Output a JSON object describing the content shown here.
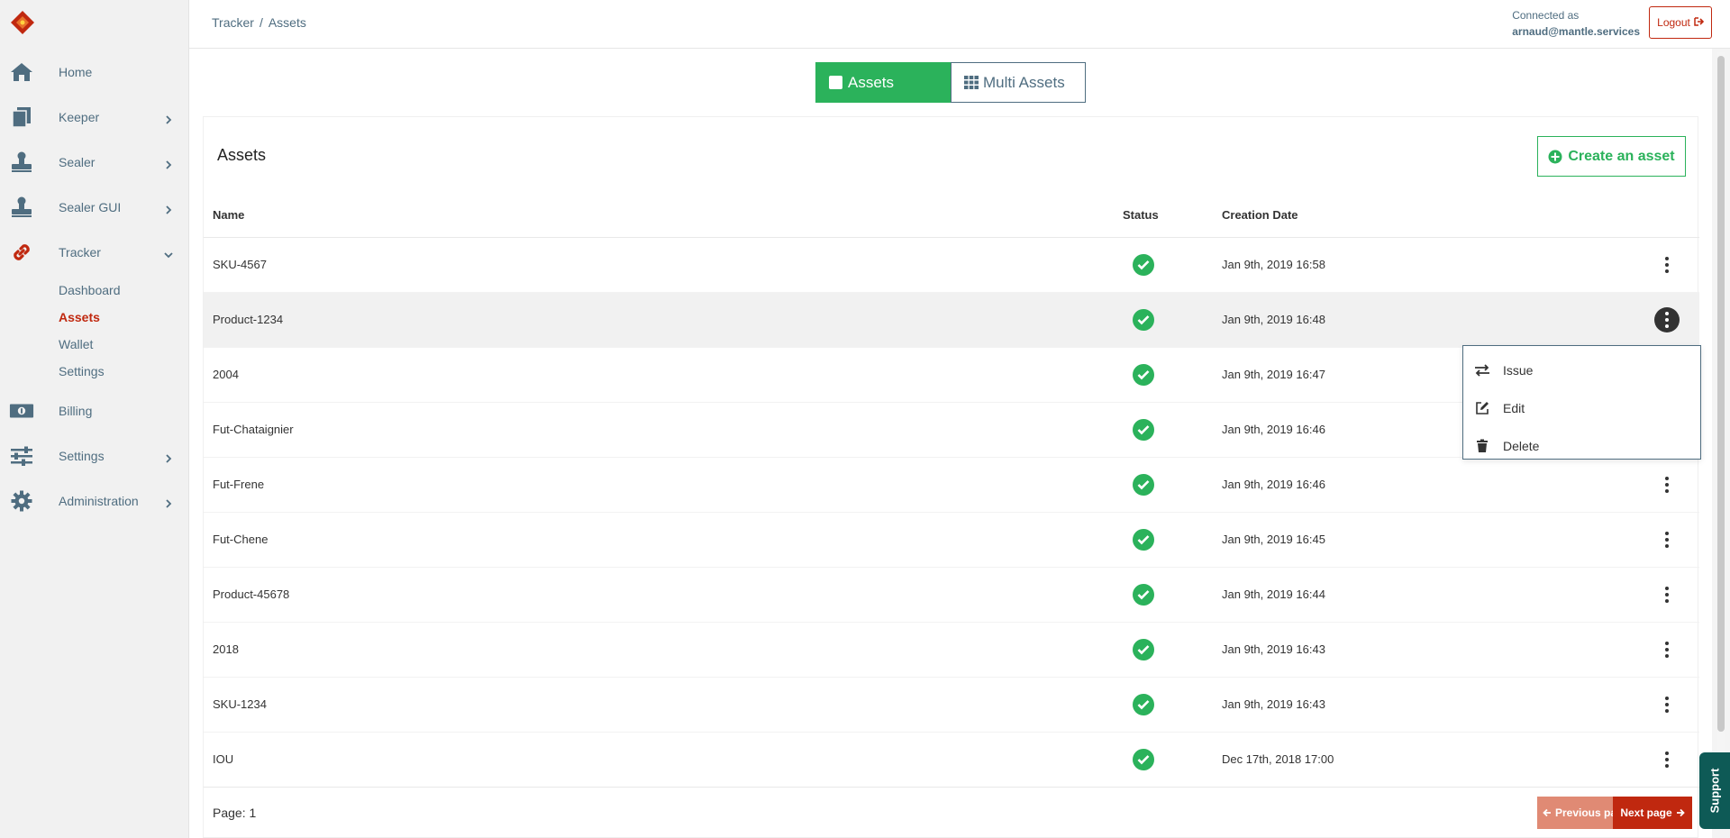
{
  "sidebar": {
    "items": [
      {
        "label": "Home",
        "icon": "home-icon"
      },
      {
        "label": "Keeper",
        "icon": "documents-icon"
      },
      {
        "label": "Sealer",
        "icon": "stamp-icon"
      },
      {
        "label": "Sealer GUI",
        "icon": "stamp-icon"
      },
      {
        "label": "Tracker",
        "icon": "link-icon"
      },
      {
        "label": "Billing",
        "icon": "money-icon"
      },
      {
        "label": "Settings",
        "icon": "sliders-icon"
      },
      {
        "label": "Administration",
        "icon": "gear-icon"
      }
    ],
    "tracker_sub": [
      "Dashboard",
      "Assets",
      "Wallet",
      "Settings"
    ]
  },
  "header": {
    "breadcrumb": [
      "Tracker",
      "Assets"
    ],
    "connected_label": "Connected as",
    "user": "arnaud@mantle.services",
    "logout_label": "Logout"
  },
  "toggle": {
    "assets_label": "Assets",
    "multi_label": "Multi Assets"
  },
  "panel": {
    "title": "Assets",
    "create_label": "Create an asset"
  },
  "table": {
    "headers": [
      "Name",
      "Status",
      "Creation Date"
    ],
    "rows": [
      {
        "name": "SKU-4567",
        "date": "Jan 9th, 2019 16:58"
      },
      {
        "name": "Product-1234",
        "date": "Jan 9th, 2019 16:48"
      },
      {
        "name": "2004",
        "date": "Jan 9th, 2019 16:47"
      },
      {
        "name": "Fut-Chataignier",
        "date": "Jan 9th, 2019 16:46"
      },
      {
        "name": "Fut-Frene",
        "date": "Jan 9th, 2019 16:46"
      },
      {
        "name": "Fut-Chene",
        "date": "Jan 9th, 2019 16:45"
      },
      {
        "name": "Product-45678",
        "date": "Jan 9th, 2019 16:44"
      },
      {
        "name": "2018",
        "date": "Jan 9th, 2019 16:43"
      },
      {
        "name": "SKU-1234",
        "date": "Jan 9th, 2019 16:43"
      },
      {
        "name": "IOU",
        "date": "Dec 17th, 2018 17:00"
      }
    ]
  },
  "menu": {
    "items": [
      "Issue",
      "Edit",
      "Delete"
    ]
  },
  "footer": {
    "page_label": "Page: 1",
    "prev_label": "Previous page",
    "next_label": "Next page"
  },
  "support_label": "Support",
  "colors": {
    "accent_green": "#2bb25b",
    "accent_red": "#c0280f",
    "nav_text": "#4f6d80"
  }
}
